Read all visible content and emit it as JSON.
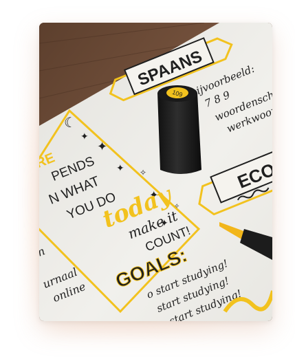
{
  "photo": {
    "title_box": "SPAANS",
    "title_box2": "ECO",
    "cap_number": "109",
    "vocab_lines": [
      "bijvoorbeeld:",
      "7 8 9",
      "woordenschat",
      "werkwoorden"
    ],
    "quote_lines": [
      "RE",
      "PENDS",
      "N WHAT",
      "YOU DO",
      "today",
      "make it",
      "COUNT!"
    ],
    "goals_title": "GOALS:",
    "goals_lines": [
      "o start studying!",
      "start studying!",
      "start studying!"
    ],
    "left_lines": [
      "n",
      "urnaal",
      "online"
    ],
    "colors": {
      "wood": "#6a4a35",
      "paper": "#efeee9",
      "marker_yellow": "#f2c21e",
      "ink": "#1f1f1f"
    }
  }
}
